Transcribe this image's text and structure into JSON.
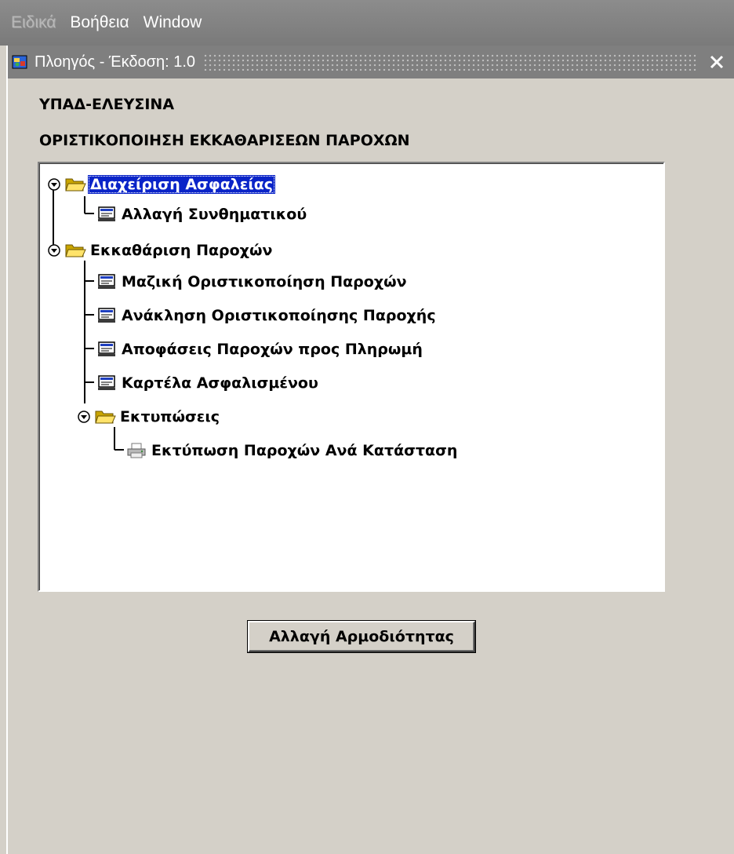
{
  "menubar": {
    "items": [
      {
        "label": "Ειδικά",
        "disabled": true
      },
      {
        "label": "Βοήθεια",
        "disabled": false
      },
      {
        "label": "Window",
        "disabled": false
      }
    ]
  },
  "window": {
    "title": "Πλοηγός - Έκδοση: 1.0",
    "org": "ΥΠΑΔ-ΕΛΕΥΣΙΝΑ",
    "module": "ΟΡΙΣΤΙΚΟΠΟΙΗΣΗ ΕΚΚΑΘΑΡΙΣΕΩΝ ΠΑΡΟΧΩΝ"
  },
  "tree": {
    "nodes": [
      {
        "label": "Διαχείριση Ασφαλείας",
        "type": "folder",
        "selected": true
      },
      {
        "label": "Αλλαγή Συνθηματικού",
        "type": "form-icon"
      },
      {
        "label": "Εκκαθάριση Παροχών",
        "type": "folder"
      },
      {
        "label": "Μαζική Οριστικοποίηση Παροχών",
        "type": "form-icon"
      },
      {
        "label": "Ανάκληση Οριστικοποίησης Παροχής",
        "type": "form-icon"
      },
      {
        "label": "Αποφάσεις Παροχών προς Πληρωμή",
        "type": "form-icon"
      },
      {
        "label": "Καρτέλα Ασφαλισμένου",
        "type": "form-icon"
      },
      {
        "label": "Εκτυπώσεις",
        "type": "folder"
      },
      {
        "label": "Εκτύπωση Παροχών Ανά Κατάσταση",
        "type": "printer-icon"
      }
    ]
  },
  "buttons": {
    "change_authority": "Αλλαγή Αρμοδιότητας"
  },
  "colors": {
    "selection": "#0a24c8",
    "window_bg": "#d4d0c8",
    "titlebar": "#7f7f7f"
  }
}
